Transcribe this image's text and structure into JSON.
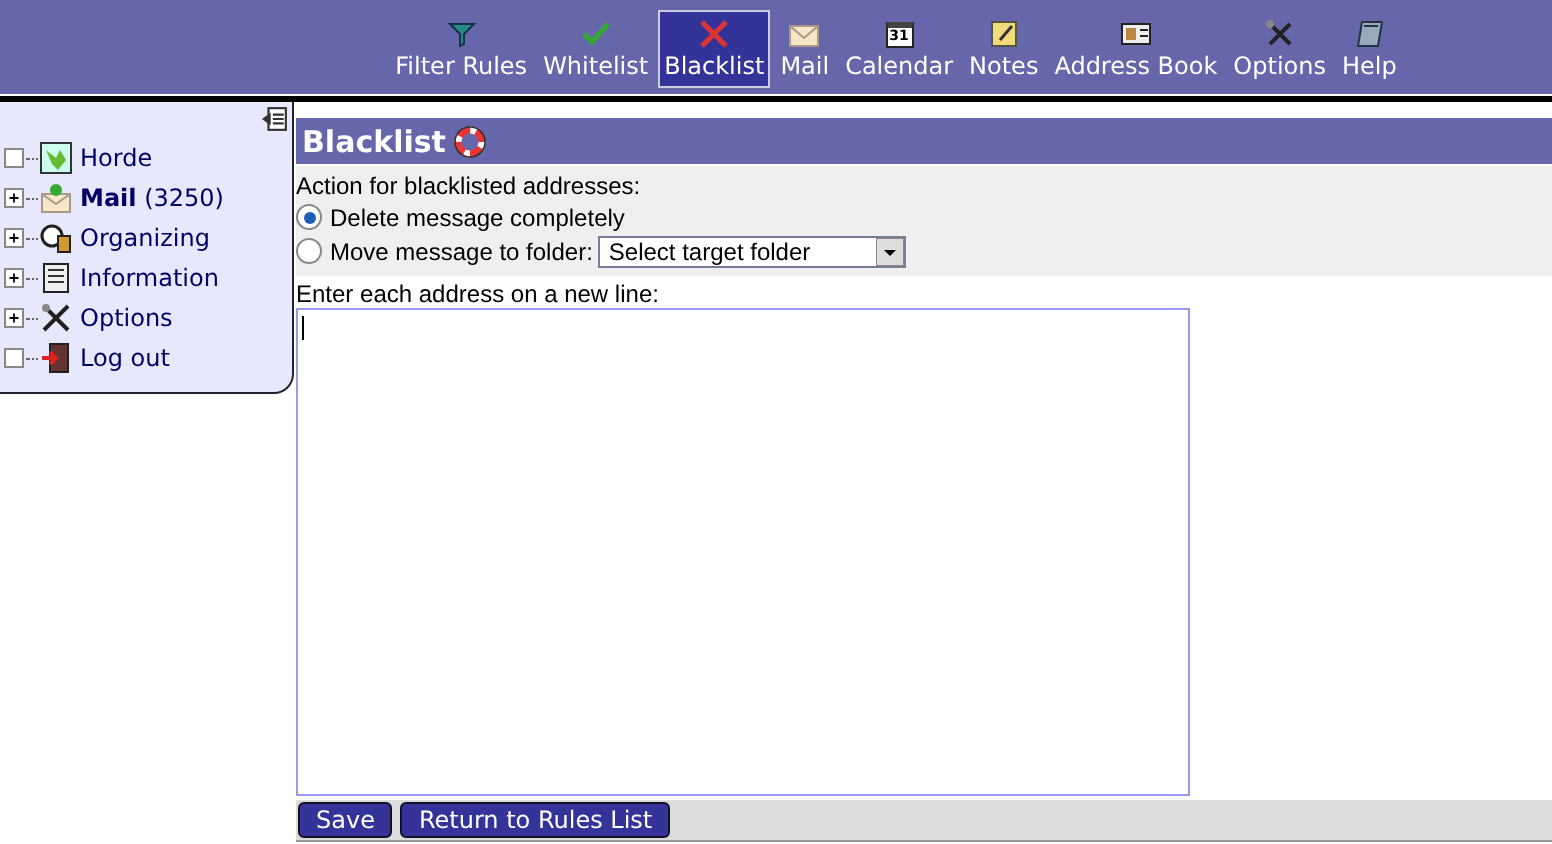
{
  "toolbar": [
    {
      "label": "Filter Rules",
      "kind": "filter",
      "selected": false
    },
    {
      "label": "Whitelist",
      "kind": "check",
      "selected": false
    },
    {
      "label": "Blacklist",
      "kind": "cross",
      "selected": true
    },
    {
      "label": "Mail",
      "kind": "envelope",
      "selected": false
    },
    {
      "label": "Calendar",
      "kind": "calendar",
      "icon_text": "31",
      "selected": false
    },
    {
      "label": "Notes",
      "kind": "note",
      "selected": false
    },
    {
      "label": "Address Book",
      "kind": "card",
      "selected": false
    },
    {
      "label": "Options",
      "kind": "tools",
      "selected": false
    },
    {
      "label": "Help",
      "kind": "book",
      "selected": false
    }
  ],
  "sidebar": {
    "items": [
      {
        "label": "Horde",
        "kind": "map",
        "expandable": false
      },
      {
        "label": "Mail",
        "count": "(3250)",
        "kind": "envelope",
        "expandable": true
      },
      {
        "label": "Organizing",
        "kind": "gears",
        "expandable": true
      },
      {
        "label": "Information",
        "kind": "doc",
        "expandable": true
      },
      {
        "label": "Options",
        "kind": "tools",
        "expandable": true
      },
      {
        "label": "Log out",
        "kind": "door",
        "expandable": false
      }
    ]
  },
  "page": {
    "title": "Blacklist",
    "action_label": "Action for blacklisted addresses:",
    "options": [
      {
        "label": "Delete message completely",
        "selected": true
      },
      {
        "label": "Move message to folder:",
        "selected": false
      }
    ],
    "folder_select": {
      "value": "Select target folder"
    },
    "addresses_label": "Enter each address on a new line:",
    "buttons": [
      "Save",
      "Return to Rules List"
    ]
  }
}
